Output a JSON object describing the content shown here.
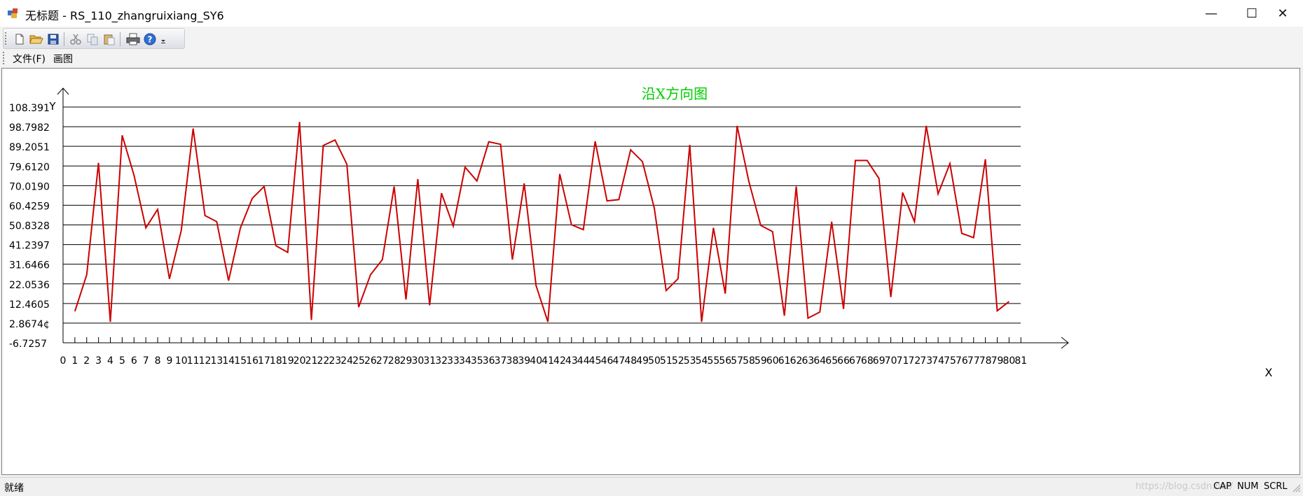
{
  "window": {
    "title": "无标题 - RS_110_zhangruixiang_SY6",
    "minimize_glyph": "—",
    "maximize_glyph": "☐",
    "close_glyph": "✕"
  },
  "toolbar": {
    "buttons": [
      "new-file-icon",
      "open-folder-icon",
      "save-icon",
      "cut-icon",
      "copy-icon",
      "paste-icon",
      "print-icon",
      "help-icon"
    ]
  },
  "menu": {
    "file": "文件(F)",
    "draw": "画图"
  },
  "status": {
    "text": "就绪",
    "cap": "CAP",
    "num": "NUM",
    "scrl": "SCRL",
    "watermark": "https://blog.csdn.net/"
  },
  "colors": {
    "line": "#cc0000",
    "title": "#00cc00",
    "axis": "#000000"
  },
  "chart_data": {
    "type": "line",
    "title": "沿X方向图",
    "xlabel": "X",
    "ylabel": "Y",
    "y_tick_labels": [
      "108.391",
      "98.7982",
      "89.2051",
      "79.6120",
      "70.0190",
      "60.4259",
      "50.8328",
      "41.2397",
      "31.6466",
      "22.0536",
      "12.4605",
      "2.8674¢",
      "-6.7257"
    ],
    "x_tick_labels": [
      "0",
      "1",
      "2",
      "3",
      "4",
      "5",
      "6",
      "7",
      "8",
      "9",
      "10",
      "11",
      "12",
      "13",
      "14",
      "15",
      "16",
      "17",
      "18",
      "19",
      "20",
      "21",
      "22",
      "23",
      "24",
      "25",
      "26",
      "27",
      "28",
      "29",
      "30",
      "31",
      "32",
      "33",
      "34",
      "35",
      "36",
      "37",
      "38",
      "39",
      "40",
      "41",
      "42",
      "43",
      "44",
      "45",
      "46",
      "47",
      "48",
      "49",
      "50",
      "51",
      "52",
      "53",
      "54",
      "55",
      "56",
      "57",
      "58",
      "59",
      "60",
      "61",
      "62",
      "63",
      "64",
      "65",
      "66",
      "67",
      "68",
      "69",
      "70",
      "71",
      "72",
      "73",
      "74",
      "75",
      "76",
      "77",
      "78",
      "79",
      "80",
      "81"
    ],
    "ylim": [
      -6.7257,
      108.391
    ],
    "xlim": [
      0,
      81
    ],
    "grid": true,
    "x": [
      1,
      2,
      3,
      4,
      5,
      6,
      7,
      8,
      9,
      10,
      11,
      12,
      13,
      14,
      15,
      16,
      17,
      18,
      19,
      20,
      21,
      22,
      23,
      24,
      25,
      26,
      27,
      28,
      29,
      30,
      31,
      32,
      33,
      34,
      35,
      36,
      37,
      38,
      39,
      40,
      41,
      42,
      43,
      44,
      45,
      46,
      47,
      48,
      49,
      50,
      51,
      52,
      53,
      54,
      55,
      56,
      57,
      58,
      59,
      60,
      61,
      62,
      63,
      64,
      65,
      66,
      67,
      68,
      69,
      70,
      71,
      72,
      73,
      74,
      75,
      76,
      77,
      78,
      79,
      80
    ],
    "y": [
      8.6,
      26.5,
      81.1,
      3.5,
      94.6,
      75.1,
      49.4,
      58.4,
      24.5,
      48.2,
      97.9,
      55.4,
      52.4,
      23.6,
      49.4,
      63.8,
      69.6,
      40.7,
      37.4,
      101.1,
      4.4,
      89.6,
      92.3,
      80.5,
      10.7,
      26.5,
      33.9,
      69.6,
      14.4,
      73.2,
      11.6,
      66.3,
      50.3,
      79.0,
      72.3,
      91.4,
      90.2,
      33.9,
      71.1,
      21.2,
      3.5,
      75.7,
      50.9,
      48.5,
      91.7,
      62.6,
      63.2,
      87.5,
      81.7,
      59.0,
      18.8,
      24.5,
      89.9,
      3.5,
      49.4,
      17.3,
      99.2,
      72.0,
      50.6,
      47.6,
      6.5,
      69.6,
      5.3,
      8.3,
      52.4,
      9.8,
      82.3,
      82.3,
      73.5,
      15.6,
      66.6,
      52.4,
      99.2,
      66.0,
      80.8,
      46.7,
      44.6,
      82.9,
      8.9,
      13.4
    ]
  }
}
